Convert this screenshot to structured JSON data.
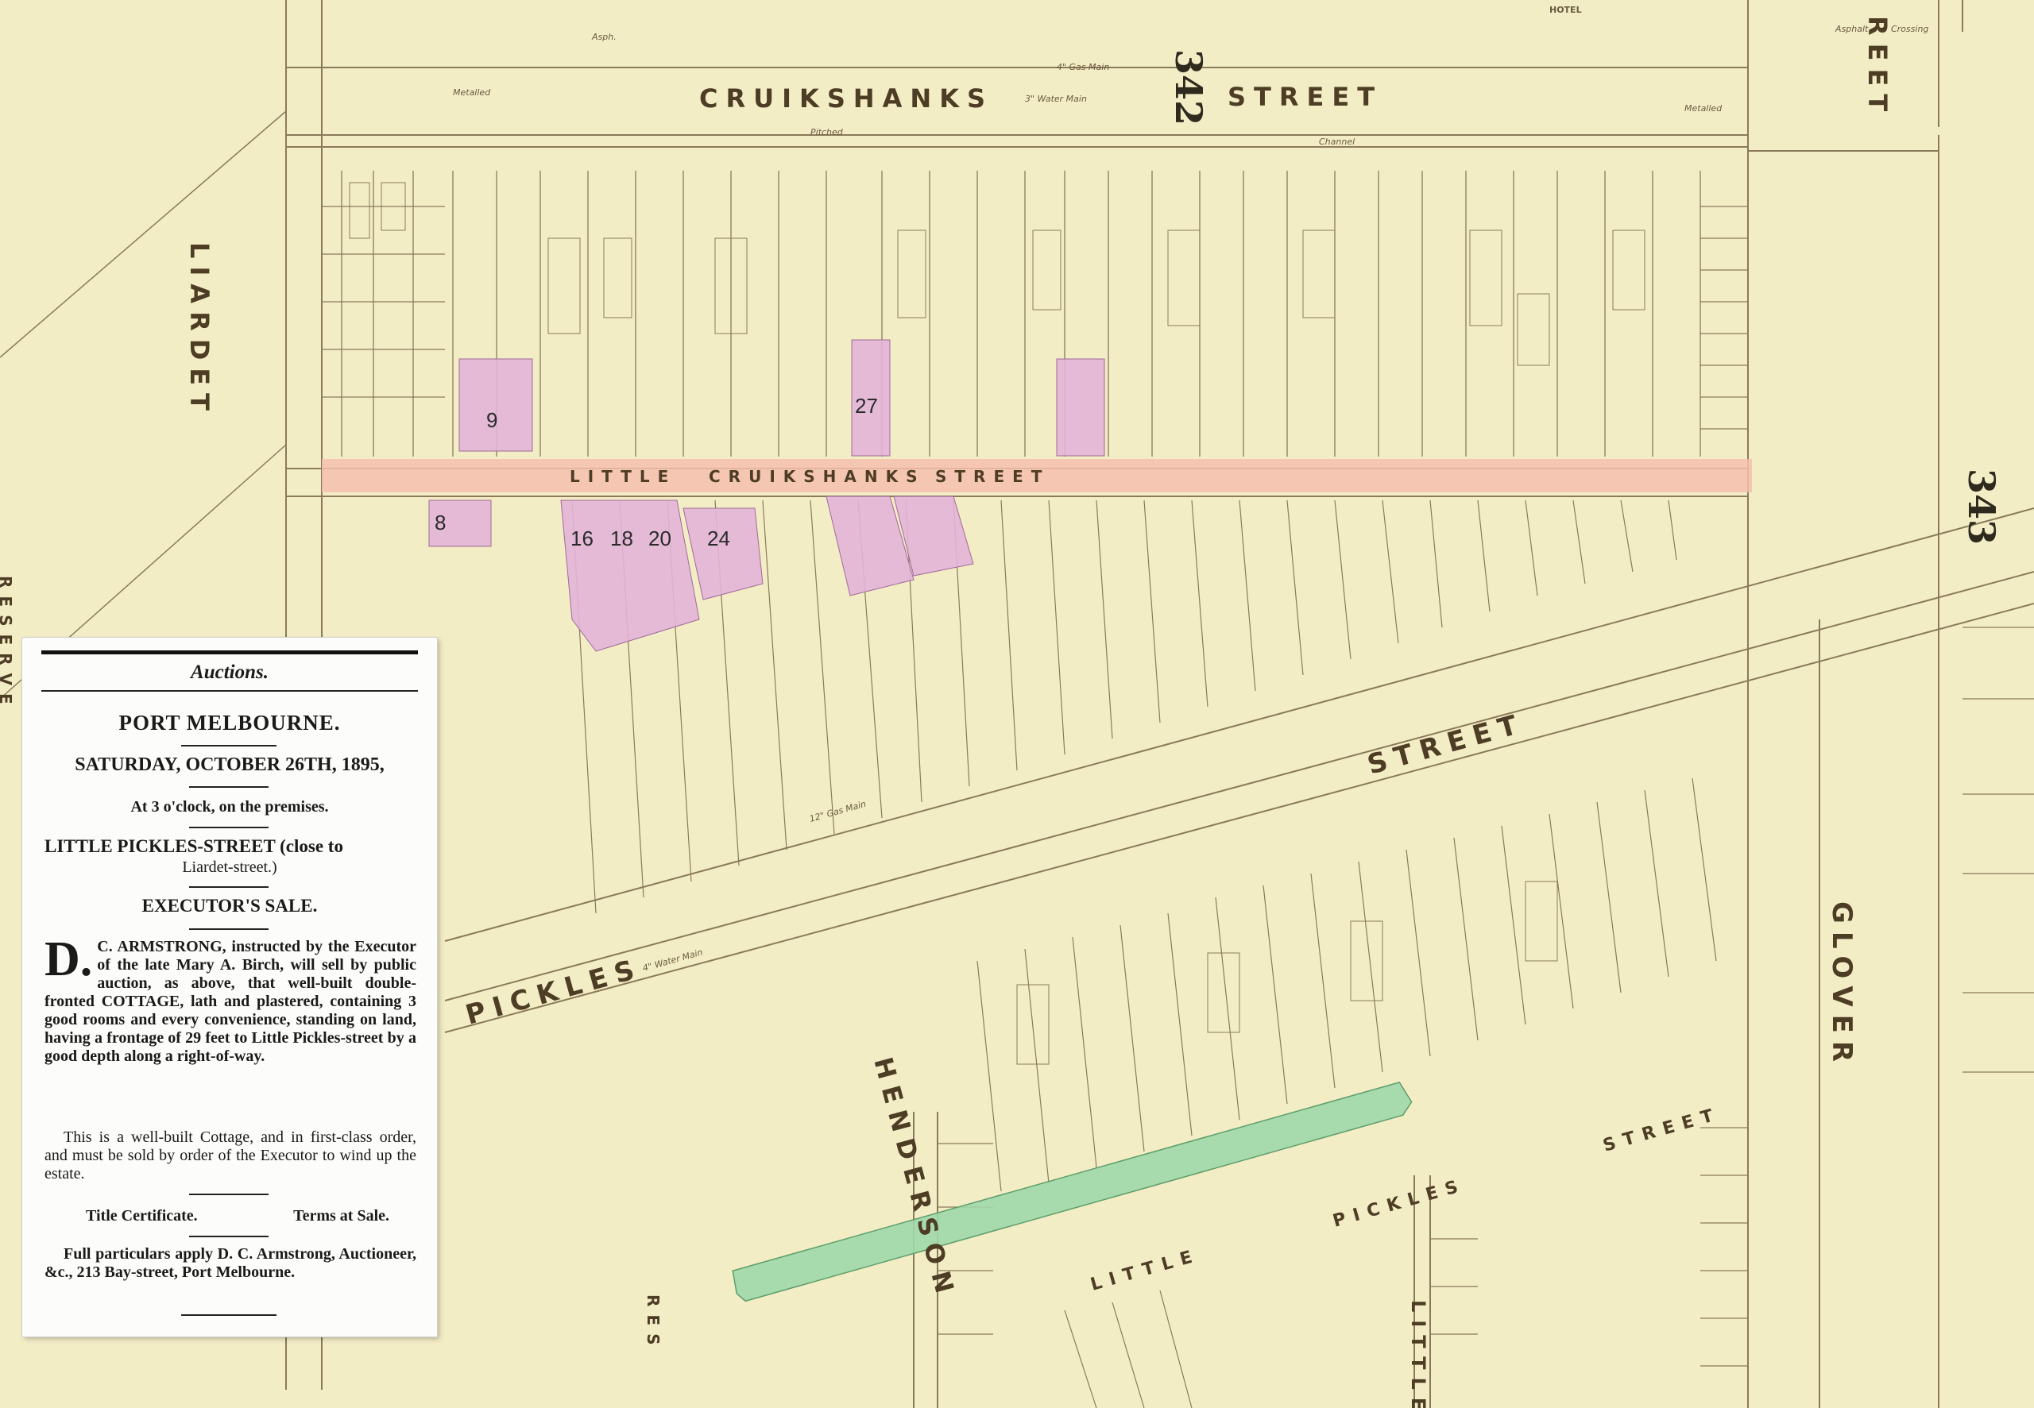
{
  "map": {
    "streets": {
      "cruikshanks": "CRUIKSHANKS",
      "cruikshanks_street": "STREET",
      "liardet": "LIARDET",
      "little_cruikshanks": [
        "LITTLE",
        "CRUIKSHANKS",
        "STREET"
      ],
      "pickles": "PICKLES",
      "pickles_street": "STREET",
      "henderson": "HENDERSON",
      "glover": "GLOVER",
      "little_pickles": [
        "LITTLE",
        "PICKLES",
        "STREET"
      ],
      "reet": "REET",
      "little_bottom": "LITTLE",
      "reserve_left": "RESERVE",
      "reserve_bottom": "RES"
    },
    "sheet_numbers": [
      "342",
      "343"
    ],
    "annotations": [
      "HOTEL",
      "Asphalt",
      "Crossing",
      "Metalled",
      "Pitched",
      "Channel",
      "Asph.",
      "4\" Gas Main",
      "3\" Water Main",
      "12\" Gas Main",
      "4\" Water Main"
    ],
    "highlighted_lots": [
      "9",
      "27",
      "8",
      "16",
      "18",
      "20",
      "24"
    ],
    "colors": {
      "paper": "#f3edc6",
      "little_cruikshanks_highlight": "#f4bfae",
      "lot_highlight": "#e2b4d8",
      "little_pickles_highlight": "#9ed7a9",
      "ink": "#8b7a5a"
    }
  },
  "clipping": {
    "section": "Auctions.",
    "place": "PORT MELBOURNE.",
    "date": "SATURDAY, OCTOBER 26TH, 1895,",
    "time": "At 3 o'clock, on the premises.",
    "location_1": "LITTLE PICKLES-STREET (close to",
    "location_2": "Liardet-street.)",
    "sale_type": "EXECUTOR'S SALE.",
    "dropcap": "D.",
    "body": "C. ARMSTRONG, instructed by the Executor of the late Mary A. Birch, will sell by public auction, as above, that well-built double-fronted COTTAGE, lath and plastered, containing 3 good rooms and every convenience, standing on land, having a frontage of 29 feet to Little Pickles-street by a good depth along a right-of-way.",
    "body_2": "This is a well-built Cottage, and in first-class order, and must be sold by order of the Executor to wind up the estate.",
    "title_cert": "Title Certificate.",
    "terms": "Terms at Sale.",
    "particulars": "Full particulars apply D. C. Armstrong, Auctioneer, &c., 213 Bay-street, Port Melbourne."
  }
}
